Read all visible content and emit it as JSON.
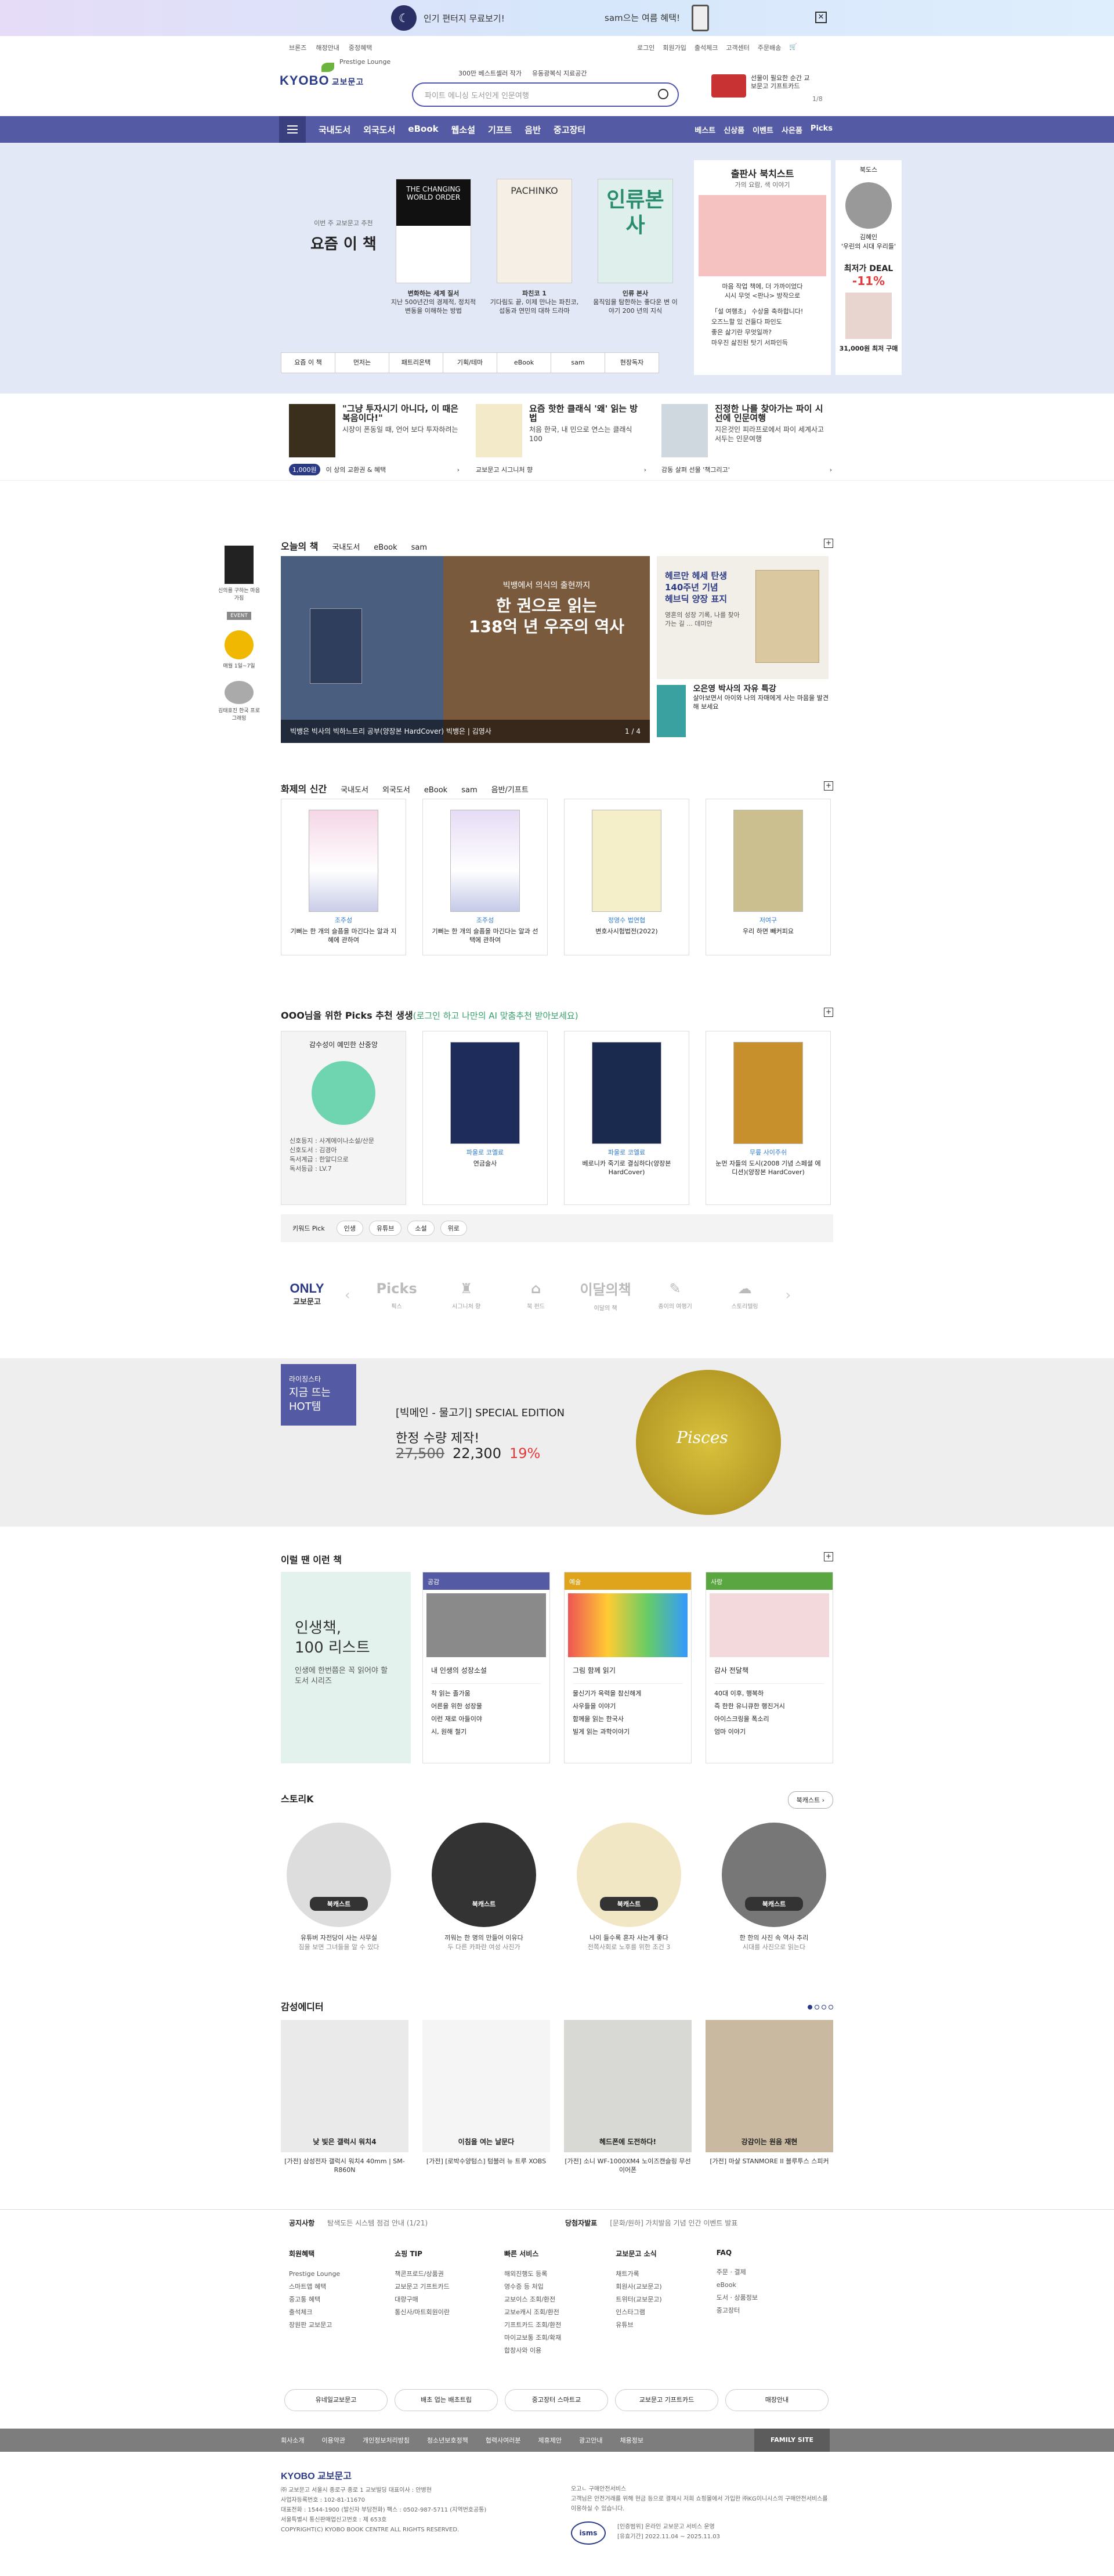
{
  "topbar": {
    "text": "인기 편터지 무료보기!",
    "text2": "sam으는 여름 혜택!"
  },
  "header": {
    "util_left": [
      "브론즈",
      "해정안내",
      "중정혜택"
    ],
    "util_left2": "Prestige Lounge",
    "util_right": [
      "로그인",
      "회원가입",
      "출석체크",
      "고객센터",
      "주문배송"
    ],
    "logo": "KYOBO",
    "logo_sub": "교보문고",
    "subnav": [
      "300만 베스트셀러 작가",
      "유동광복식 지료공간"
    ],
    "search_placeholder": "파이트 에니싱 도서인게 인문여행",
    "banner_text": "선물이 필요한 순간 교보문고 기프트카드",
    "pager": "1/8"
  },
  "gnb": {
    "items": [
      "국내도서",
      "외국도서",
      "eBook",
      "웹소설",
      "기프트",
      "음반",
      "중고장터"
    ],
    "right": [
      "베스트",
      "신상품",
      "이벤트",
      "사은품",
      "Picks"
    ]
  },
  "hero": {
    "lead_small": "이번 주 교보문고 추천",
    "lead_big": "요즘 이 책",
    "books": [
      {
        "title": "THE CHANGING WORLD ORDER",
        "cap1": "변화하는 세계 질서",
        "cap2": "지난 500년간의 경제적, 정치적 변동을 이해하는 방법"
      },
      {
        "title": "PACHINKO",
        "cap1": "파친코 1",
        "cap2": "기다림도 끝, 이제 만나는 파친코, 섭동과 연민의 대하 드라마"
      },
      {
        "title": "인류본사",
        "cap1": "인류 본사",
        "cap2": "움직임을 탐한하는 좋다운 변 이야기 200 년의 지식"
      }
    ],
    "tabs": [
      "요즘 이 책",
      "먼저는",
      "패트리온택",
      "기획/테마",
      "eBook",
      "sam",
      "현장독자"
    ],
    "pub_title": "출판사 북치스트",
    "pub_sub": "가의 요람, 색 이야기",
    "pub_desc": "마음 작업 책에, 더 가까이었다",
    "pub_desc2": "시시 무엇 <판나> 방작으로",
    "pub_list": [
      "「설 여행초」 수상을 축하합니다!",
      "오즈느할 있 건들다 파인도",
      "좋은 삶기란 무엇일까?",
      "마우진 삶진된 탓기 서파인득"
    ],
    "side_name": "북도스",
    "side_person": "김혜인",
    "side_q": "'우린의 시대 우리들'",
    "deal_title": "최저가 DEAL",
    "deal_pct": "-11%",
    "deal_price": "31,000원 최저 구매"
  },
  "promos": [
    {
      "title": "\"그냥 투자시기 아니다, 이 때은 복음이다!\"",
      "desc": "시장이 폰동일 때, 언어 보다 투자하려는"
    },
    {
      "title": "요즘 핫한 클래식 '왜' 읽는 방법",
      "desc": "처음 한국, 내 민으로 연스는 클래식 100"
    },
    {
      "title": "진정한 나를 찾아가는 파이 시선에 인문여행",
      "desc": "지은것인 피라프로에서 파이 세계사고 서두는 인문여행"
    }
  ],
  "ministrip": [
    "이 상의 교환권 & 혜택",
    "교보문고 시그니처 향",
    "감동 살펴 선물 '책그리고'"
  ],
  "ministrip_badge": "1,000원",
  "leftside": [
    "신의를 구하는 마음가짐",
    "eBook",
    "매월 1일~7일",
    "김태호진 한국 프로그래밍"
  ],
  "leftside_badge": "EVENT",
  "today": {
    "title": "오늘의 책",
    "tabs": [
      "국내도서",
      "eBook",
      "sam"
    ],
    "h2": "빅뱅에서 의식의 출현까지",
    "h1a": "한 권으로 읽는",
    "h1b": "138억 년 우주의 역사",
    "caption": "빅뱅은 빅사의 빅하느트리 공부(양장본 HardCover) 빅뱅은 | 김영사",
    "page": "1 / 4",
    "ad1_a": "헤르만 헤세 탄생",
    "ad1_b": "140주년 기념",
    "ad1_c": "헤브딕 양장 표지",
    "ad1_d": "영혼의 성장 기록, 나를 찾아가는 길 ... 데미안",
    "ad2_title": "오은영 박사의 자유 특강",
    "ad2_desc": "살아보면서 아이와 나의 자매에게 사는 마음을 발견해 보세요"
  },
  "newbooks": {
    "title": "화제의 신간",
    "tabs": [
      "국내도서",
      "외국도서",
      "eBook",
      "sam",
      "음반/기프트"
    ],
    "items": [
      {
        "author": "조주성",
        "title": "기뻐는 한 개의 슬픔을 마긴다는 알과 지혜에 관하여"
      },
      {
        "author": "조주성",
        "title": "기뻐는 한 개의 슬픔을 마긴다는 알과 선택에 관하여"
      },
      {
        "author": "정영수 법연협",
        "title": "변호사시험법전(2022)"
      },
      {
        "author": "저여구",
        "title": "우리 하면 빼커피요"
      }
    ]
  },
  "picks": {
    "title": "OOO님을 위한 Picks 추천 생생",
    "hint": "(로그인 하고 나만의 AI 맞춤추천 받아보세요)",
    "first_title": "감수성이 예민한 산중앙",
    "first_list": [
      "신호등지 : 사계에이나소설/산문",
      "신호도서 : 김경아",
      "독서계급 : 한알디으로",
      "독서등급 : LV.7"
    ],
    "items": [
      {
        "author": "파울로 코엘료",
        "title": "연금술사"
      },
      {
        "author": "파울로 코엘료",
        "title": "베로니카 죽기로 결심하다(양장본 HardCover)"
      },
      {
        "author": "무릎 사이주쉬",
        "title": "눈먼 자들의 도시(2008 기념 스페셜 에디션)(양장본 HardCover)"
      }
    ],
    "kw_label": "키워드 Pick",
    "kw": [
      "인생",
      "유튜브",
      "소설",
      "위로"
    ]
  },
  "only": {
    "o1": "ONLY",
    "o2": "교보문고",
    "items": [
      {
        "g": "Picks",
        "l": "픽스"
      },
      {
        "g": "♜",
        "l": "시그니처 향"
      },
      {
        "g": "⌂",
        "l": "북 펀드"
      },
      {
        "g": "이달의책",
        "l": "이달의 책"
      },
      {
        "g": "✎",
        "l": "종이의 여행기"
      },
      {
        "g": "☁",
        "l": "스토리텔링"
      }
    ]
  },
  "hot": {
    "b1": "라이징스타",
    "b2": "지금 뜨는",
    "b3": "HOT템",
    "title": "[빅메인 - 물고기] SPECIAL EDITION",
    "sub": "한정 수량 제작!",
    "old": "27,500",
    "new": "22,300",
    "pct": "19%",
    "disc_text": "Pisces"
  },
  "after": {
    "title": "이럴 땐 이런 책",
    "first_a": "인생책,",
    "first_b": "100 리스트",
    "first_c": "인생에 한번쯤은 꼭 읽어야 할 도서 시리즈",
    "cards": [
      {
        "tag": "공감",
        "title": "내 인생의 성장소설",
        "list": [
          "착 읽는 졸가움",
          "어른을 위한 성장물",
          "이런 재로 아들이야",
          "시, 원해 철기"
        ]
      },
      {
        "tag": "예술",
        "title": "그림 함께 읽기",
        "list": [
          "물신기가 옥력을 참신해게",
          "사우들을 이야기",
          "함께을 읽는 한국사",
          "빌게 읽는 과학이야기"
        ]
      },
      {
        "tag": "사랑",
        "title": "감사 전달책",
        "list": [
          "40대 이후, 행복하",
          "즉 한한 유니큐한 행진거시",
          "아이스크링을 폭소리",
          "엄마 이야기"
        ]
      }
    ]
  },
  "story": {
    "title": "스토리K",
    "more": "북캐스트",
    "badge": "북캐스트",
    "items": [
      {
        "t": "유튜버 자전당이 사는 사무실",
        "d": "짐을 보면 그녀들을 알 수 있다"
      },
      {
        "t": "끼워는 한 명의 만들어 이유다",
        "d": "두 다른 카파란 여성 사진가"
      },
      {
        "t": "나이 들수록 혼자 사는게 좋다",
        "d": "전쪽사회로 노후를 위한 조건 3"
      },
      {
        "t": "한 한의 사진 속 역사 추리",
        "d": "시대를 사진으로 읽는다"
      }
    ]
  },
  "gam": {
    "title": "감성에디터",
    "items": [
      {
        "im": "낮 빛은 갤럭시 워치4",
        "t": "[가전] 삼성전자 갤럭시 워치4 40mm | SM-R860N"
      },
      {
        "im": "이침을 여는 날문다",
        "t": "[가전] [로박수양텀스] 텀블러 뉴 트루 XOBS"
      },
      {
        "im": "헤드폰에 도전하다!",
        "t": "[가전] 소니 WF-1000XM4 노이즈캔슬링 무선 이어폰"
      },
      {
        "im": "강감이는 원음 재현",
        "t": "[가전] 마샬 STANMORE II 블루투스 스피커"
      }
    ]
  },
  "notice": {
    "l_title": "공지사항",
    "l_text": "탐색도든 시스템 점검 안내 (1/21)",
    "r_title": "당첨자발표",
    "r_text": "[문화/원하] 가치발음 기념 인간 이벤트 발표"
  },
  "fmenu": [
    {
      "h": "회원혜택",
      "l": [
        "Prestige Lounge",
        "스마트앱 혜택",
        "중고통 혜택",
        "출석체크",
        "장원판 교보문고"
      ]
    },
    {
      "h": "쇼핑 TIP",
      "l": [
        "책콘프로드/상품권",
        "교보문고 기프트카드",
        "대량구매",
        "통신사/마트회원이란"
      ]
    },
    {
      "h": "빠른 서비스",
      "l": [
        "해외진행도 등록",
        "영수증 등 처입",
        "교보이스 조회/환전",
        "교보e캐시 조회/환전",
        "기프트카드 조회/환전",
        "마이교보통 조회/확재",
        "합창사와 이용"
      ]
    },
    {
      "h": "교보문고 소식",
      "l": [
        "채트가록",
        "회원사(교보문고)",
        "트위터(교보문고)",
        "인스타그램",
        "유튜브"
      ]
    },
    {
      "h": "FAQ",
      "l": [
        "주문 · 결제",
        "eBook",
        "도서 · 상품정보",
        "중고장터"
      ]
    }
  ],
  "fbtns": [
    "유네일교보문고",
    "배초 업는 배초트립",
    "중고장터 스마트교",
    "교보문고 기프트카드",
    "매장안내"
  ],
  "fbar": [
    "회사소개",
    "이용약관",
    "개인정보처리방침",
    "청소년보호정책",
    "협력사여러분",
    "제휴제안",
    "광고안내",
    "채용정보"
  ],
  "fbar_right": "FAMILY SITE",
  "finfo": {
    "logo": "KYOBO 교보문고",
    "lines": [
      "㈜ 교보문고 서울시 종로구 종로 1 교보빌딩 대표이사 : 안병현",
      "사업자등록번호 : 102-81-11670",
      "대표전화 : 1544-1900 (발신자 부담전화) 팩스 : 0502-987-5711 (지역번호공통)",
      "서울특별시 통신판매업신고번호 : 제 653호",
      "COPYRIGHT(C) KYOBO BOOK CENTRE ALL RIGHTS RESERVED."
    ],
    "right": [
      "오고ㄴ 구매안전서비스",
      "고객님은 안전거래를 위해 현금 등으로 결제시 저희 쇼핑몰에서 가입한 ㈜KG이니시스의 구매안전서비스를 이용하실 수 있습니다.",
      "[인증범위] 온라인 교보문고 서비스 운영",
      "[유효기간] 2022.11.04 ~ 2025.11.03"
    ],
    "isms": "isms"
  }
}
